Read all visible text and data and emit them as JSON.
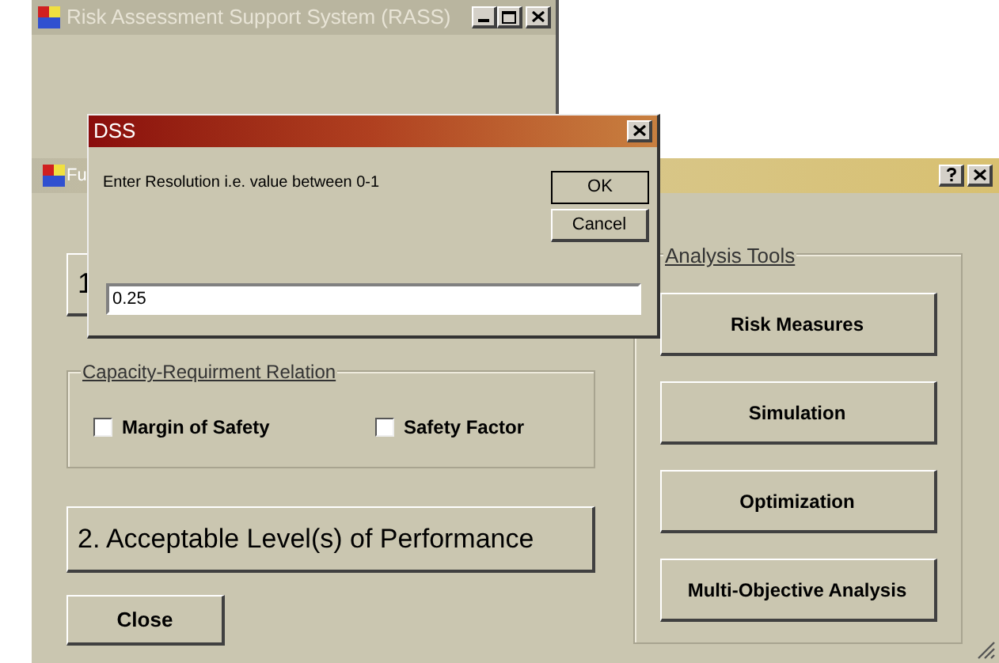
{
  "main_window": {
    "title": "Risk Assessment Support System (RASS)"
  },
  "fuzzy_window": {
    "title": "Fu",
    "step_1_button": "1",
    "capacity_group": {
      "title": "Capacity-Requirment Relation",
      "options": [
        {
          "label": "Margin of Safety",
          "checked": false
        },
        {
          "label": "Safety Factor",
          "checked": false
        }
      ]
    },
    "step_2_button": "2. Acceptable Level(s) of Performance",
    "close_button": "Close",
    "analysis_tools": {
      "title": "Analysis Tools",
      "buttons": [
        "Risk Measures",
        "Simulation",
        "Optimization",
        "Multi-Objective Analysis"
      ]
    }
  },
  "dialog": {
    "title": "DSS",
    "prompt": "Enter Resolution i.e. value between 0-1",
    "ok": "OK",
    "cancel": "Cancel",
    "value": "0.25"
  }
}
